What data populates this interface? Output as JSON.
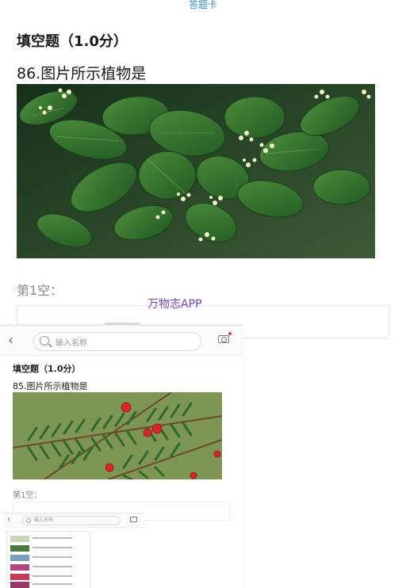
{
  "header": {
    "answer_card": "答题卡"
  },
  "question": {
    "type": "填空题（1.0分）",
    "text": "86.图片所示植物是",
    "blank_label": "第1空："
  },
  "watermark": "万物志APP",
  "nested_screenshot": {
    "search_placeholder": "输入名称",
    "question_type": "填空题（1.0分）",
    "question_text": "85.图片所示植物是",
    "blank_label": "第1空："
  },
  "nested_screenshot_2": {
    "search_placeholder": "输入名称"
  },
  "colors": {
    "accent": "#3a8fd8",
    "watermark": "#7b3fc9",
    "leaf": "#2f6a2c",
    "berry": "#d8272a"
  },
  "icons": [
    "back-icon",
    "search-icon",
    "camera-icon"
  ]
}
